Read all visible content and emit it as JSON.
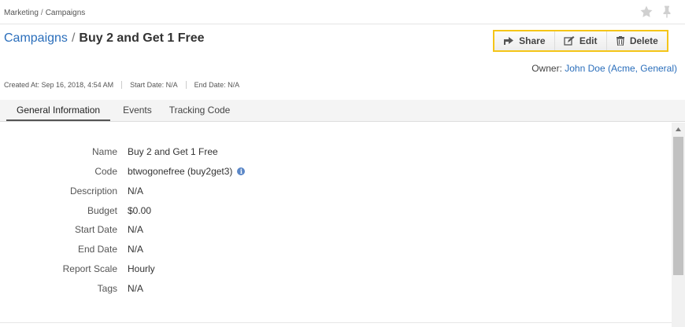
{
  "breadcrumb": {
    "items": [
      "Marketing",
      "Campaigns"
    ],
    "separator": "/"
  },
  "icons": {
    "favorite": "star-icon",
    "pin": "pin-icon",
    "share": "share-icon",
    "edit": "edit-icon",
    "delete": "trash-icon",
    "info": "info-icon"
  },
  "title": {
    "link": "Campaigns",
    "separator": "/",
    "current": "Buy 2 and Get 1 Free"
  },
  "actions": {
    "share": "Share",
    "edit": "Edit",
    "delete": "Delete"
  },
  "owner": {
    "label": "Owner:",
    "name": "John Doe",
    "org": "(Acme, General)"
  },
  "meta": {
    "created": "Created At: Sep 16, 2018, 4:54 AM",
    "start": "Start Date: N/A",
    "end": "End Date: N/A"
  },
  "tabs": [
    "General Information",
    "Events",
    "Tracking Code"
  ],
  "fields": [
    {
      "label": "Name",
      "value": "Buy 2 and Get 1 Free"
    },
    {
      "label": "Code",
      "value": "btwogonefree (buy2get3)"
    },
    {
      "label": "Description",
      "value": "N/A"
    },
    {
      "label": "Budget",
      "value": "$0.00"
    },
    {
      "label": "Start Date",
      "value": "N/A"
    },
    {
      "label": "End Date",
      "value": "N/A"
    },
    {
      "label": "Report Scale",
      "value": "Hourly"
    },
    {
      "label": "Tags",
      "value": "N/A"
    }
  ],
  "colors": {
    "accent": "#2a6ebb",
    "highlight": "#f5c518"
  }
}
